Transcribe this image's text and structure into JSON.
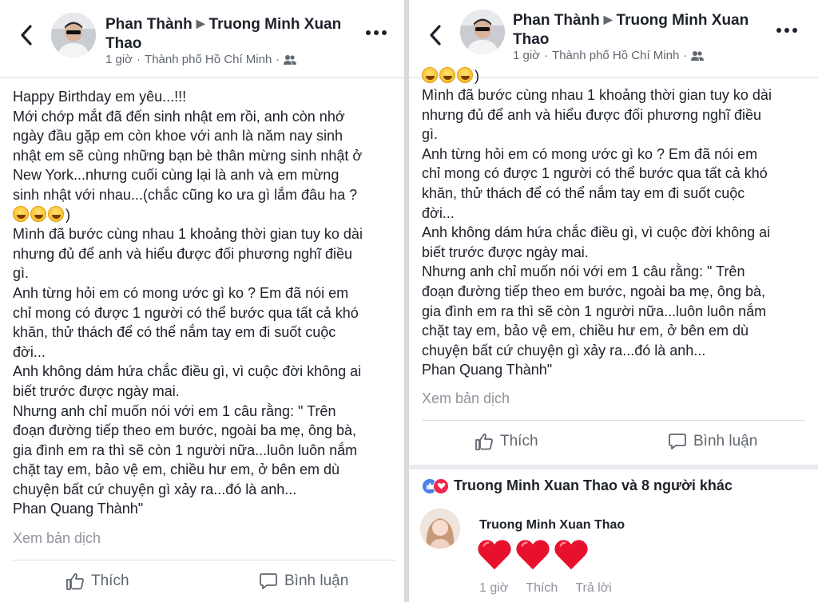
{
  "post": {
    "author": "Phan Thành",
    "recipient": "Truong Minh Xuan Thao",
    "time": "1 giờ",
    "location": "Thành phố Hồ Chí Minh",
    "separator": "·",
    "audience_icon": "friends-icon"
  },
  "left_body": {
    "lines_before_emoji": "Happy Birthday em yêu...!!!\nMới chớp mắt đã đến sinh nhật em rồi, anh còn nhớ\nngày đầu gặp em còn khoe với anh là năm nay sinh\nnhật em sẽ cùng những bạn bè thân mừng sinh nhật ở\nNew York...nhưng cuối cùng lại là anh và em mừng\nsinh nhật với nhau...(chắc cũng ko ưa gì lắm đâu ha ?",
    "emoji_close": ")",
    "lines_after_emoji": "Mình đã bước cùng nhau 1 khoảng thời gian tuy ko dài\nnhưng đủ để anh và hiểu được đối phương nghĩ điều\ngì.\nAnh từng hỏi em có mong ước gì ko ? Em đã nói em\nchỉ mong có được 1 người có thể bước qua tất cả khó\nkhăn, thử thách để có thể nắm tay em đi suốt cuộc\nđời...\nAnh không dám hứa chắc điều gì, vì cuộc đời không ai\nbiết trước được ngày mai.\nNhưng anh chỉ muốn nói với em 1 câu rằng: \" Trên\nđoạn đường tiếp theo em bước, ngoài ba mẹ, ông bà,\ngia đình em ra thì sẽ còn 1 người nữa...luôn luôn nắm\nchặt tay em, bảo vệ em, chiều hư em, ở bên em dù\nchuyện bất cứ chuyện gì xảy ra...đó là anh...\nPhan Quang Thành\""
  },
  "right_body": {
    "emoji_close": ")",
    "lines": "Mình đã bước cùng nhau 1 khoảng thời gian tuy ko dài\nnhưng đủ để anh và hiểu được đối phương nghĩ điều\ngì.\nAnh từng hỏi em có mong ước gì ko ? Em đã nói em\nchỉ mong có được 1 người có thể bước qua tất cả khó\nkhăn, thử thách để có thể nắm tay em đi suốt cuộc\nđời...\nAnh không dám hứa chắc điều gì, vì cuộc đời không ai\nbiết trước được ngày mai.\nNhưng anh chỉ muốn nói với em 1 câu rằng: \" Trên\nđoạn đường tiếp theo em bước, ngoài ba mẹ, ông bà,\ngia đình em ra thì sẽ còn 1 người nữa...luôn luôn nắm\nchặt tay em, bảo vệ em, chiều hư em, ở bên em dù\nchuyện bất cứ chuyện gì xảy ra...đó là anh...\nPhan Quang Thành\""
  },
  "translate_label": "Xem bản dịch",
  "actions": {
    "like_label": "Thích",
    "comment_label": "Bình luận"
  },
  "reactions": {
    "summary": "Truong Minh Xuan Thao và 8 người khác"
  },
  "comment": {
    "author": "Truong Minh Xuan Thao",
    "time": "1 giờ",
    "like_label": "Thích",
    "reply_label": "Trả lời"
  },
  "colors": {
    "heart": "#e8112d",
    "like_blue": "#4a7ee8",
    "love_red": "#f0284a",
    "muted": "#90949c"
  }
}
